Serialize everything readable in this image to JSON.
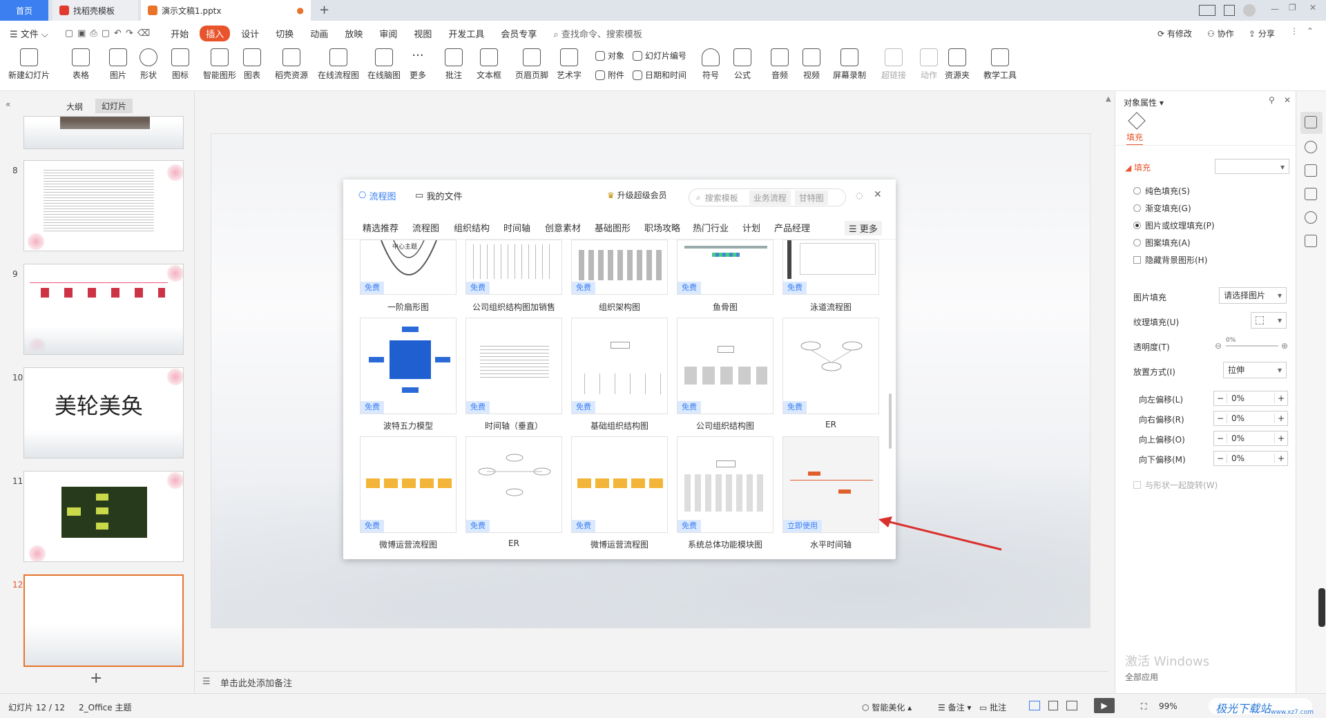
{
  "tabs": {
    "home": "首页",
    "template": "找稻壳模板",
    "doc": "演示文稿1.pptx"
  },
  "menu": {
    "file": "文件",
    "items": [
      "开始",
      "插入",
      "设计",
      "切换",
      "动画",
      "放映",
      "审阅",
      "视图",
      "开发工具",
      "会员专享"
    ],
    "active": "插入",
    "search": "查找命令、搜索模板",
    "right": [
      "有修改",
      "协作",
      "分享"
    ]
  },
  "ribbon": {
    "big": [
      "新建幻灯片",
      "表格",
      "图片",
      "形状",
      "图标",
      "智能图形",
      "图表",
      "稻壳资源",
      "在线流程图",
      "在线脑图",
      "更多",
      "批注",
      "文本框",
      "页眉页脚",
      "艺术字",
      "符号",
      "公式",
      "音频",
      "视频",
      "屏幕录制",
      "超链接",
      "动作",
      "资源夹",
      "教学工具"
    ],
    "small": [
      "对象",
      "附件",
      "幻灯片编号",
      "日期和时间"
    ]
  },
  "left": {
    "tabs": [
      "大纲",
      "幻灯片"
    ],
    "slides": [
      "8",
      "9",
      "10",
      "11",
      "12"
    ],
    "calligraphy": "美轮美奂"
  },
  "dialog": {
    "tab1": "流程图",
    "tab2": "我的文件",
    "vip": "升级超级会员",
    "search": "搜索模板",
    "chips": [
      "业务流程",
      "甘特图"
    ],
    "categories": [
      "精选推荐",
      "流程图",
      "组织结构",
      "时间轴",
      "创意素材",
      "基础图形",
      "职场攻略",
      "热门行业",
      "计划",
      "产品经理"
    ],
    "more": "更多",
    "row1": [
      "一阶扇形图",
      "公司组织结构图加销售",
      "组织架构图",
      "鱼骨图",
      "泳道流程图"
    ],
    "row2": [
      "波特五力模型",
      "时间轴（垂直）",
      "基础组织结构图",
      "公司组织结构图",
      "ER"
    ],
    "row3": [
      "微博运营流程图",
      "ER",
      "微博运营流程图",
      "系统总体功能模块图",
      "水平时间轴"
    ],
    "free": "免费",
    "use_now": "立即使用",
    "center_topic": "中心主题"
  },
  "right": {
    "title": "对象属性",
    "tab": "填充",
    "section": "填充",
    "options": [
      "纯色填充(S)",
      "渐变填充(G)",
      "图片或纹理填充(P)",
      "图案填充(A)"
    ],
    "selected_option": "图片或纹理填充(P)",
    "hide_bg": "隐藏背景图形(H)",
    "picture_fill": "图片填充",
    "picture_fill_value": "请选择图片",
    "texture_fill": "纹理填充(U)",
    "transparency": "透明度(T)",
    "transparency_value": "0%",
    "placement": "放置方式(I)",
    "placement_value": "拉伸",
    "offsets": [
      {
        "label": "向左偏移(L)",
        "value": "0%"
      },
      {
        "label": "向右偏移(R)",
        "value": "0%"
      },
      {
        "label": "向上偏移(O)",
        "value": "0%"
      },
      {
        "label": "向下偏移(M)",
        "value": "0%"
      }
    ],
    "rotate": "与形状一起旋转(W)"
  },
  "notes": "单击此处添加备注",
  "status": {
    "slide": "幻灯片 12 / 12",
    "theme": "2_Office 主题",
    "beautify": "智能美化",
    "notes": "备注",
    "comment": "批注",
    "zoom": "99%",
    "watermark": "激活 Windows",
    "watermark2": "全部应用",
    "site": "极光下载站",
    "site_url": "www.xz7.com"
  },
  "colors": {
    "accent": "#3b7ff0",
    "insert": "#e8542b",
    "arrow": "#d9302c"
  }
}
